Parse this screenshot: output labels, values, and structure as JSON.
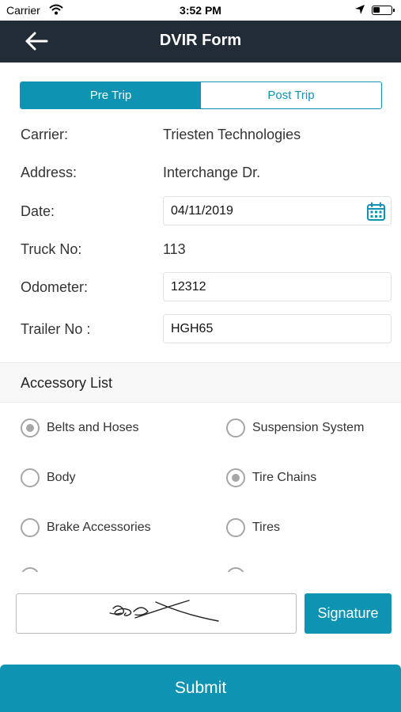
{
  "status_bar": {
    "carrier": "Carrier",
    "time": "3:52 PM",
    "battery_level": 0.4,
    "icons": [
      "wifi-icon",
      "location-arrow-icon",
      "battery-icon"
    ]
  },
  "header": {
    "title": "DVIR Form",
    "back_icon": "arrow-left-icon"
  },
  "trip_toggle": {
    "pre_trip": "Pre Trip",
    "post_trip": "Post Trip",
    "selected": "Pre Trip"
  },
  "form": {
    "carrier_label": "Carrier:",
    "carrier_value": "Triesten Technologies",
    "address_label": "Address:",
    "address_value": "Interchange Dr.",
    "date_label": "Date:",
    "date_value": "04/11/2019",
    "truck_label": "Truck No:",
    "truck_value": "113",
    "odometer_label": "Odometer:",
    "odometer_value": "12312",
    "trailer_label": "Trailer No :",
    "trailer_value": "HGH65"
  },
  "accessory": {
    "title": "Accessory List",
    "items": [
      {
        "label": "Belts and Hoses",
        "checked": true
      },
      {
        "label": "Suspension System",
        "checked": false
      },
      {
        "label": "Body",
        "checked": false
      },
      {
        "label": "Tire Chains",
        "checked": true
      },
      {
        "label": "Brake Accessories",
        "checked": false
      },
      {
        "label": "Tires",
        "checked": false
      },
      {
        "label": "",
        "checked": false
      },
      {
        "label": "",
        "checked": false
      }
    ]
  },
  "signature": {
    "button_label": "Signature"
  },
  "submit_label": "Submit",
  "colors": {
    "accent": "#0e93b3",
    "header_bg": "#222c37"
  }
}
